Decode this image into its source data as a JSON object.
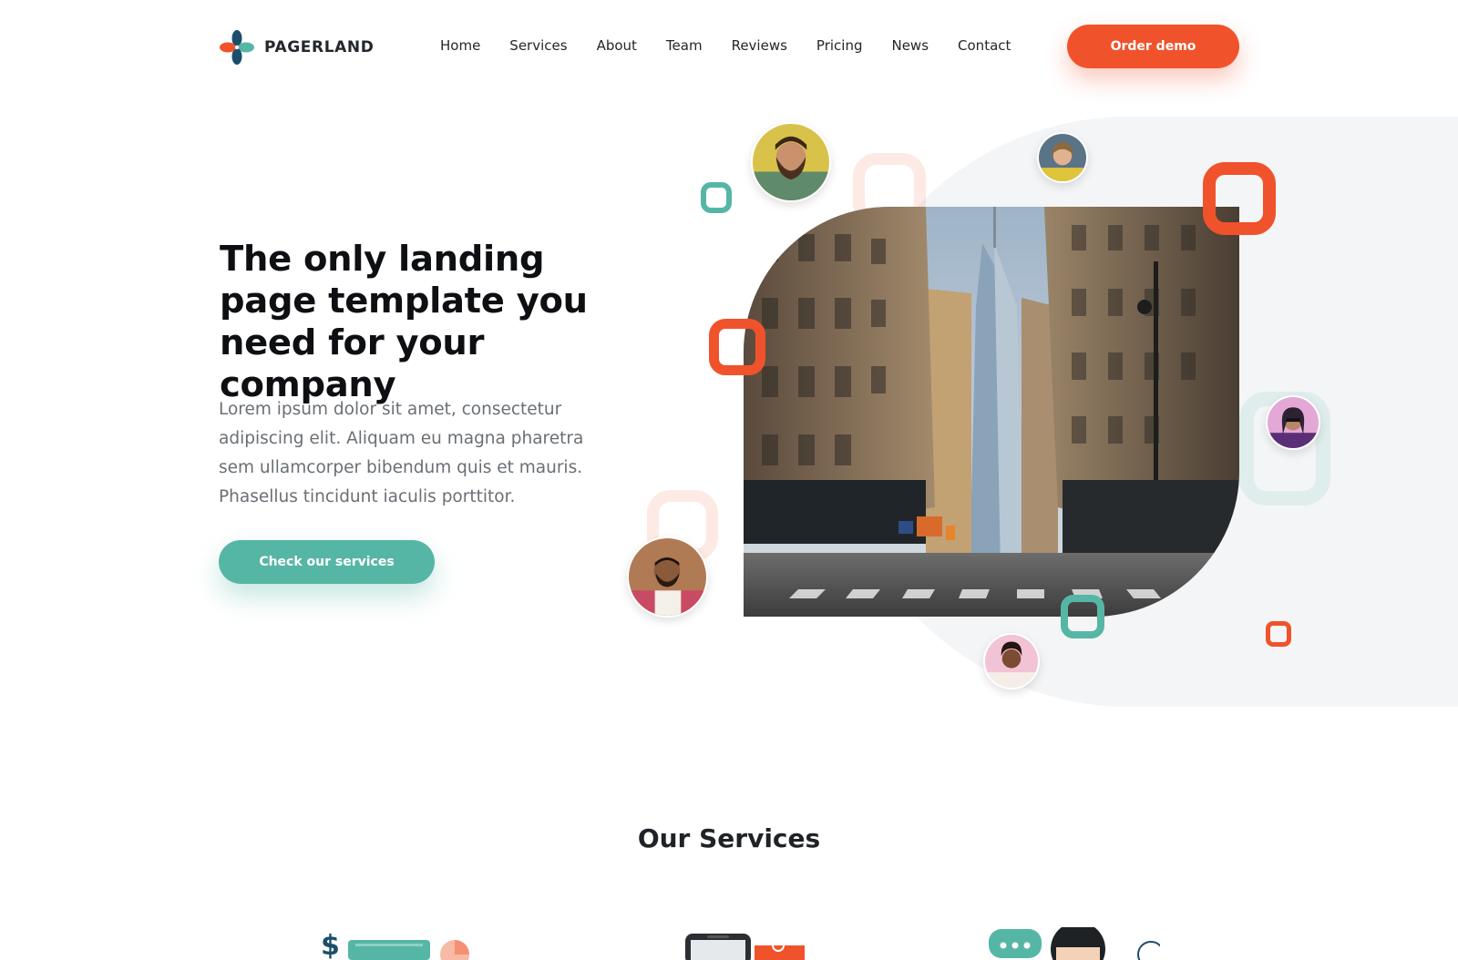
{
  "brand": {
    "name": "PAGERLAND",
    "colors": {
      "orange": "#f0532b",
      "teal": "#56b6a5",
      "navy": "#1c4e6b"
    }
  },
  "nav": {
    "items": [
      {
        "label": "Home"
      },
      {
        "label": "Services"
      },
      {
        "label": "About"
      },
      {
        "label": "Team"
      },
      {
        "label": "Reviews"
      },
      {
        "label": "Pricing"
      },
      {
        "label": "News"
      },
      {
        "label": "Contact"
      }
    ],
    "cta_label": "Order demo"
  },
  "hero": {
    "title": "The only landing page template you need for your company",
    "description": "Lorem ipsum dolor sit amet, consectetur adipiscing elit. Aliquam eu magna pharetra sem ullamcorper bibendum quis et mauris. Phasellus tincidunt iaculis porttitor.",
    "button_label": "Check our services",
    "image_alt": "city-street-photo"
  },
  "services": {
    "title": "Our Services",
    "icons": [
      "finance-icon",
      "mobile-icon",
      "support-icon"
    ]
  }
}
